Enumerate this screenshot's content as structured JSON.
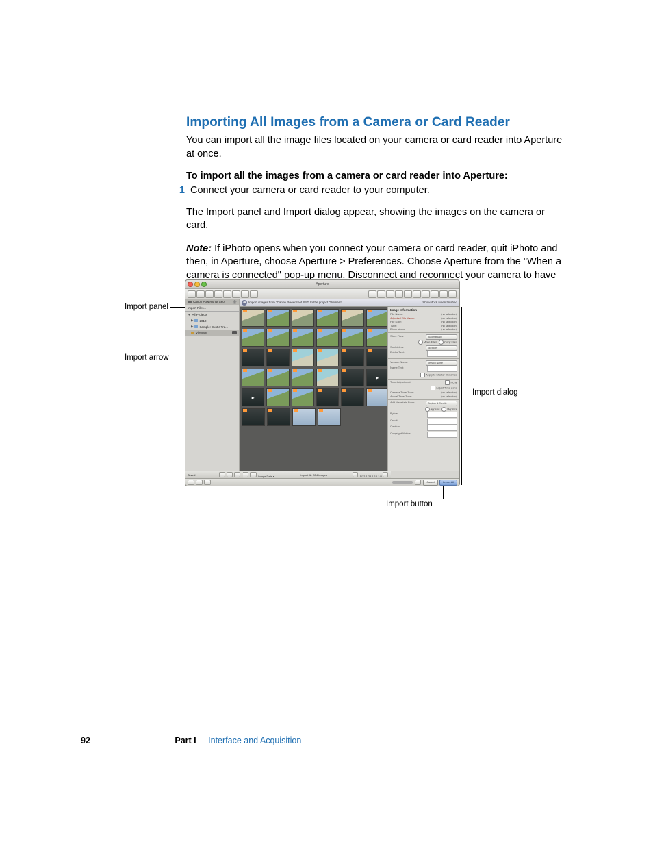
{
  "heading": "Importing All Images from a Camera or Card Reader",
  "intro": "You can import all the image files located on your camera or card reader into Aperture at once.",
  "subheading": "To import all the images from a camera or card reader into Aperture:",
  "step1_num": "1",
  "step1_text": "Connect your camera or card reader to your computer.",
  "para2": "The Import panel and Import dialog appear, showing the images on the camera or card.",
  "note_prefix": "Note:",
  "note_body": "  If iPhoto opens when you connect your camera or card reader, quit iPhoto and then, in Aperture, choose Aperture > Preferences. Choose Aperture from the \"When a camera is connected\" pop-up menu. Disconnect and reconnect your camera to have Aperture open the Import dialog.",
  "callouts": {
    "import_panel": "Import panel",
    "import_arrow": "Import arrow",
    "import_dialog": "Import dialog",
    "import_button": "Import button"
  },
  "screenshot": {
    "window_title": "Aperture",
    "sidebar": {
      "camera": "Canon PowerShot S60",
      "import_files": "Import Files...",
      "all_projects": "All Projects",
      "year": "2010",
      "sample": "Sample: Exotic Tra...",
      "project": "Vietnam"
    },
    "import_bar": {
      "text": "Import images from \"Canon PowerShot S40\" to the project \"Vietnam\".",
      "eject_label": "Show dock when finished"
    },
    "dialog": {
      "header": "Image Information",
      "file_name_label": "File Name:",
      "file_name_val": "(no selection)",
      "adj_file_name_label": "Adjusted File Name:",
      "adj_file_name_val": "(no selection)",
      "file_date_label": "File Date:",
      "file_date_val": "(no selection)",
      "type_label": "Type:",
      "type_val": "(no selection)",
      "dimensions_label": "Dimensions:",
      "dimensions_val": "(no selection)",
      "store_files_label": "Store Files:",
      "store_files_val": "Automatically",
      "move_files": "Move Files",
      "copy_files": "Copy Files",
      "subfolders_label": "Subfolders:",
      "subfolders_val": "No folder",
      "folder_text_label": "Folder Text:",
      "version_name_label": "Version Name:",
      "version_name_val": "Version Name",
      "name_text_label": "Name Text:",
      "apply_master": "Apply to Master filenames",
      "time_adj_label": "Time Adjustment:",
      "time_adj_none": "None",
      "time_adj_adjust": "Adjust Time Zone",
      "camera_tz_label": "Camera Time Zone:",
      "camera_tz_val": "(no selection)",
      "actual_tz_label": "Actual Time Zone:",
      "actual_tz_val": "(no selection)",
      "add_meta_label": "Add Metadata From:",
      "add_meta_val": "Caption & Credits",
      "append": "Append",
      "replace": "Replace",
      "byline_label": "Byline:",
      "credit_label": "Credit:",
      "caption_label": "Caption:",
      "copyright_label": "Copyright Notice:"
    },
    "grid_bottom": {
      "image_date": "Image Date",
      "count": "Import All: 354 images",
      "zoom_steps": "1/32   1/24   1/16   1/8"
    },
    "status": {
      "search": "Search",
      "cancel": "Cancel",
      "import": "Import All"
    }
  },
  "footer": {
    "page": "92",
    "part": "Part I",
    "chapter": "Interface and Acquisition"
  }
}
